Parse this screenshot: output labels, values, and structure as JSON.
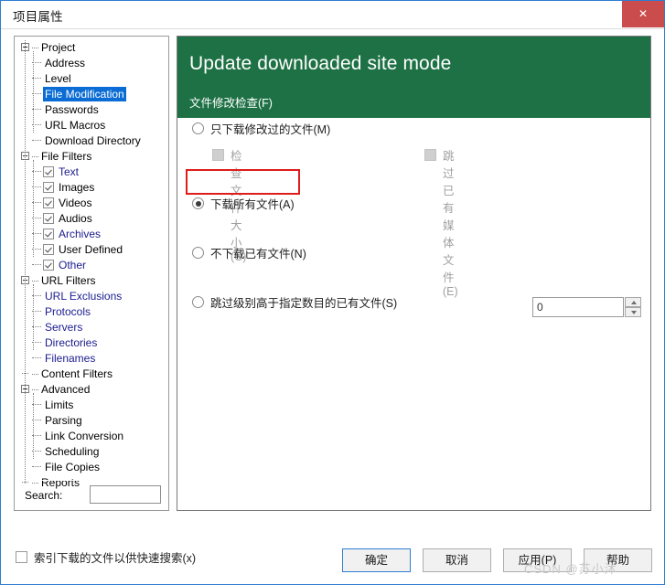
{
  "window": {
    "title": "项目属性",
    "close_label": "✕"
  },
  "tree": {
    "nodes": [
      {
        "label": "Project",
        "level": 0,
        "type": "expander",
        "color": "black",
        "selected": false
      },
      {
        "label": "Address",
        "level": 1,
        "type": "leaf",
        "color": "black",
        "selected": false
      },
      {
        "label": "Level",
        "level": 1,
        "type": "leaf",
        "color": "black",
        "selected": false
      },
      {
        "label": "File Modification",
        "level": 1,
        "type": "leaf",
        "color": "black",
        "selected": true
      },
      {
        "label": "Passwords",
        "level": 1,
        "type": "leaf",
        "color": "black",
        "selected": false
      },
      {
        "label": "URL Macros",
        "level": 1,
        "type": "leaf",
        "color": "black",
        "selected": false
      },
      {
        "label": "Download Directory",
        "level": 1,
        "type": "leaf",
        "color": "black",
        "selected": false
      },
      {
        "label": "File Filters",
        "level": 0,
        "type": "expander",
        "color": "black",
        "selected": false
      },
      {
        "label": "Text",
        "level": 1,
        "type": "checkbox",
        "color": "blue",
        "checked": true
      },
      {
        "label": "Images",
        "level": 1,
        "type": "checkbox",
        "color": "black",
        "checked": true
      },
      {
        "label": "Videos",
        "level": 1,
        "type": "checkbox",
        "color": "black",
        "checked": true
      },
      {
        "label": "Audios",
        "level": 1,
        "type": "checkbox",
        "color": "black",
        "checked": true
      },
      {
        "label": "Archives",
        "level": 1,
        "type": "checkbox",
        "color": "blue",
        "checked": true
      },
      {
        "label": "User Defined",
        "level": 1,
        "type": "checkbox",
        "color": "black",
        "checked": true
      },
      {
        "label": "Other",
        "level": 1,
        "type": "checkbox",
        "color": "blue",
        "checked": true
      },
      {
        "label": "URL Filters",
        "level": 0,
        "type": "expander",
        "color": "black",
        "selected": false
      },
      {
        "label": "URL Exclusions",
        "level": 1,
        "type": "leaf",
        "color": "blue",
        "selected": false
      },
      {
        "label": "Protocols",
        "level": 1,
        "type": "leaf",
        "color": "blue",
        "selected": false
      },
      {
        "label": "Servers",
        "level": 1,
        "type": "leaf",
        "color": "blue",
        "selected": false
      },
      {
        "label": "Directories",
        "level": 1,
        "type": "leaf",
        "color": "blue",
        "selected": false
      },
      {
        "label": "Filenames",
        "level": 1,
        "type": "leaf",
        "color": "blue",
        "selected": false
      },
      {
        "label": "Content Filters",
        "level": 0,
        "type": "leaf",
        "color": "black",
        "selected": false
      },
      {
        "label": "Advanced",
        "level": 0,
        "type": "expander",
        "color": "black",
        "selected": false
      },
      {
        "label": "Limits",
        "level": 1,
        "type": "leaf",
        "color": "black",
        "selected": false
      },
      {
        "label": "Parsing",
        "level": 1,
        "type": "leaf",
        "color": "black",
        "selected": false
      },
      {
        "label": "Link Conversion",
        "level": 1,
        "type": "leaf",
        "color": "black",
        "selected": false
      },
      {
        "label": "Scheduling",
        "level": 1,
        "type": "leaf",
        "color": "black",
        "selected": false
      },
      {
        "label": "File Copies",
        "level": 1,
        "type": "leaf",
        "color": "black",
        "selected": false
      },
      {
        "label": "Reports",
        "level": 0,
        "type": "leaf",
        "color": "black",
        "selected": false
      }
    ]
  },
  "search": {
    "label": "Search:",
    "value": "",
    "placeholder": ""
  },
  "panel": {
    "header_title": "Update downloaded site mode",
    "header_subtitle": "文件修改检查(F)",
    "header_color": "#1e7145",
    "options": [
      {
        "label": "只下载修改过的文件(M)",
        "selected": false
      },
      {
        "label": "下载所有文件(A)",
        "selected": true
      },
      {
        "label": "不下载已有文件(N)",
        "selected": false
      },
      {
        "label": "跳过级别高于指定数目的已有文件(S)",
        "selected": false
      }
    ],
    "suboptions": [
      {
        "label": "检查文件大小(C)",
        "checked": false,
        "disabled": true
      },
      {
        "label": "跳过已有媒体文件(E)",
        "checked": false,
        "disabled": true
      }
    ],
    "spinner": {
      "value": "0"
    },
    "annotation_color": "#e01b1b"
  },
  "footer": {
    "index_checkbox_label": "索引下载的文件以供快速搜索(x)",
    "index_checked": false,
    "buttons": {
      "ok": "确定",
      "cancel": "取消",
      "apply": "应用(P)",
      "help": "帮助"
    }
  },
  "watermark": "CSDN @苏小沐"
}
